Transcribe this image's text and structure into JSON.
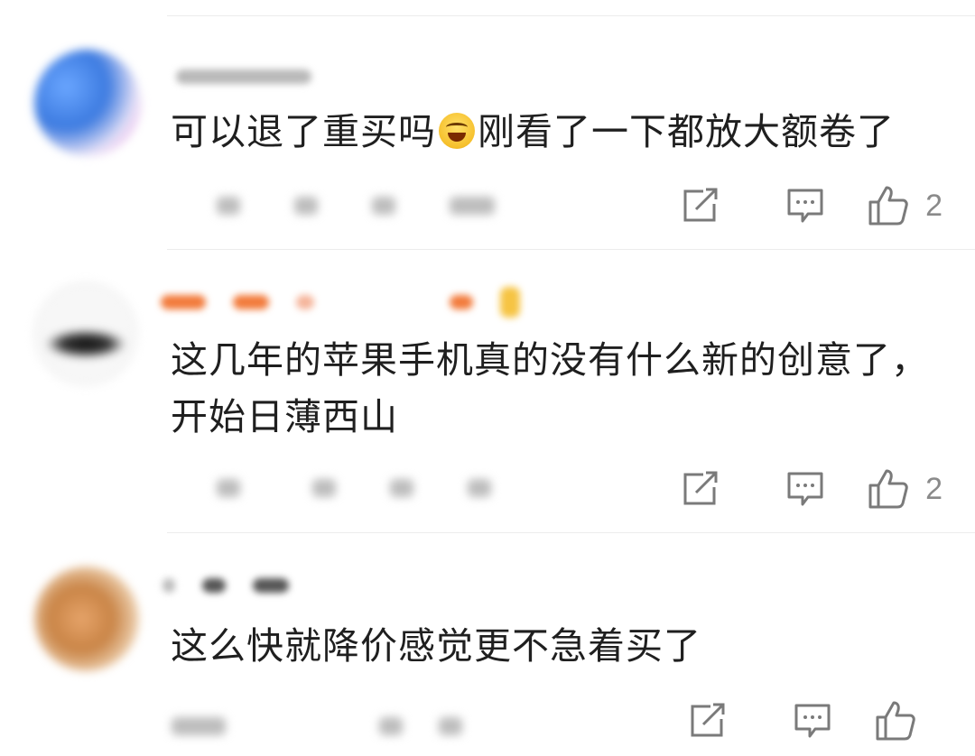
{
  "comments": [
    {
      "text_before_emoji": "可以退了重买吗",
      "emoji": "laughing-crying-emoji",
      "text_after_emoji": "刚看了一下都放大额卷了",
      "like_count": "2"
    },
    {
      "text": "这几年的苹果手机真的没有什么新的创意了，开始日薄西山",
      "like_count": "2"
    },
    {
      "text": "这么快就降价感觉更不急着买了",
      "like_count": ""
    }
  ],
  "colors": {
    "text": "#1f1f1f",
    "icon": "#7a7a7a",
    "divider": "#ececec"
  },
  "icons": [
    "share-icon",
    "reply-icon",
    "like-icon"
  ]
}
